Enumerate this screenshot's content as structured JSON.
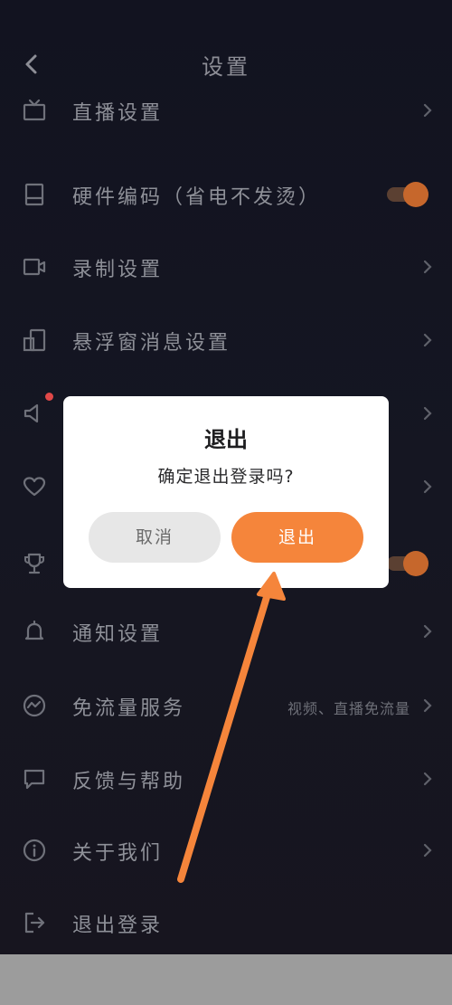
{
  "header": {
    "title": "设置",
    "back_icon": "chevron-left-icon"
  },
  "settings": {
    "items": [
      {
        "label": "直播设置",
        "icon": "tv-icon",
        "type": "link"
      },
      {
        "label": "硬件编码（省电不发烫）",
        "icon": "chip-icon",
        "type": "toggle",
        "toggle_on": true
      },
      {
        "label": "录制设置",
        "icon": "video-camera-icon",
        "type": "link"
      },
      {
        "label": "悬浮窗消息设置",
        "icon": "float-window-icon",
        "type": "link"
      },
      {
        "label": "",
        "icon": "speaker-icon",
        "type": "link",
        "badge": "red-dot"
      },
      {
        "label": "",
        "icon": "heart-icon",
        "type": "link"
      },
      {
        "label": "",
        "icon": "trophy-icon",
        "type": "toggle",
        "toggle_on": true
      },
      {
        "label": "通知设置",
        "icon": "bell-icon",
        "type": "link"
      },
      {
        "label": "免流量服务",
        "icon": "traffic-icon",
        "type": "link",
        "extra": "视频、直播免流量"
      },
      {
        "label": "反馈与帮助",
        "icon": "chat-icon",
        "type": "link"
      },
      {
        "label": "关于我们",
        "icon": "info-icon",
        "type": "link"
      },
      {
        "label": "退出登录",
        "icon": "logout-icon",
        "type": "link"
      }
    ]
  },
  "dialog": {
    "title": "退出",
    "message": "确定退出登录吗?",
    "cancel_label": "取消",
    "confirm_label": "退出"
  },
  "colors": {
    "accent": "#f5853b",
    "background": "#141520",
    "text_muted": "#8e9098",
    "annotation_arrow": "#f5853b"
  }
}
